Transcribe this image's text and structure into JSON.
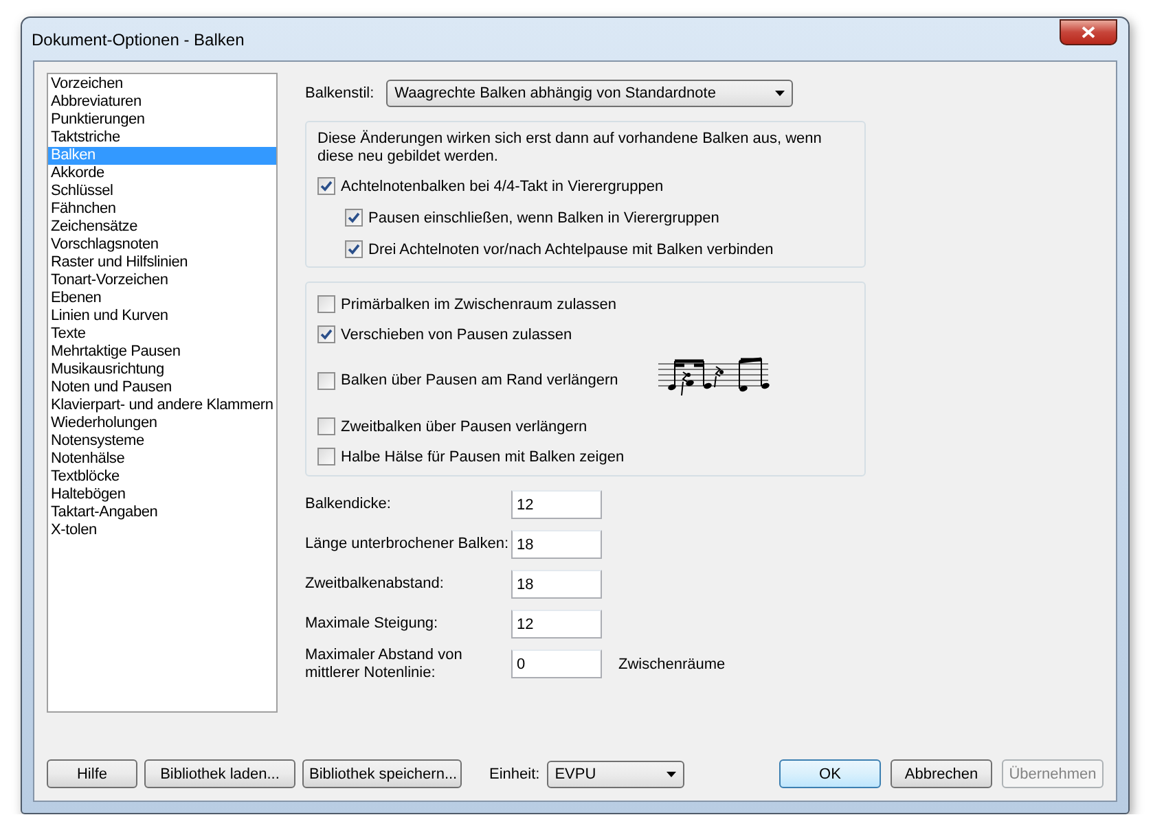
{
  "window": {
    "title": "Dokument-Optionen - Balken"
  },
  "sidebar": {
    "items": [
      {
        "label": "Vorzeichen",
        "selected": false
      },
      {
        "label": "Abbreviaturen",
        "selected": false
      },
      {
        "label": "Punktierungen",
        "selected": false
      },
      {
        "label": "Taktstriche",
        "selected": false
      },
      {
        "label": "Balken",
        "selected": true
      },
      {
        "label": "Akkorde",
        "selected": false
      },
      {
        "label": "Schlüssel",
        "selected": false
      },
      {
        "label": "Fähnchen",
        "selected": false
      },
      {
        "label": "Zeichensätze",
        "selected": false
      },
      {
        "label": "Vorschlagsnoten",
        "selected": false
      },
      {
        "label": "Raster und Hilfslinien",
        "selected": false
      },
      {
        "label": "Tonart-Vorzeichen",
        "selected": false
      },
      {
        "label": "Ebenen",
        "selected": false
      },
      {
        "label": "Linien und Kurven",
        "selected": false
      },
      {
        "label": "Texte",
        "selected": false
      },
      {
        "label": "Mehrtaktige Pausen",
        "selected": false
      },
      {
        "label": "Musikausrichtung",
        "selected": false
      },
      {
        "label": "Noten und Pausen",
        "selected": false
      },
      {
        "label": "Klavierpart- und andere Klammern",
        "selected": false
      },
      {
        "label": "Wiederholungen",
        "selected": false
      },
      {
        "label": "Notensysteme",
        "selected": false
      },
      {
        "label": "Notenhälse",
        "selected": false
      },
      {
        "label": "Textblöcke",
        "selected": false
      },
      {
        "label": "Haltebögen",
        "selected": false
      },
      {
        "label": "Taktart-Angaben",
        "selected": false
      },
      {
        "label": "X-tolen",
        "selected": false
      }
    ]
  },
  "beam_style": {
    "label": "Balkenstil:",
    "value": "Waagrechte Balken abhängig von Standardnote"
  },
  "group_1": {
    "note": "Diese Änderungen wirken sich erst dann auf vorhandene Balken aus, wenn diese neu gebildet werden.",
    "checkboxes": [
      {
        "label": "Achtelnotenbalken bei 4/4-Takt in Vierergruppen",
        "checked": true,
        "children": [
          {
            "label": "Pausen einschließen, wenn Balken in Vierergruppen",
            "checked": true
          },
          {
            "label": "Drei Achtelnoten vor/nach Achtelpause mit Balken verbinden",
            "checked": true
          }
        ]
      }
    ]
  },
  "group_2": {
    "checkboxes": [
      {
        "label": "Primärbalken im Zwischenraum zulassen",
        "checked": false
      },
      {
        "label": "Verschieben von Pausen zulassen",
        "checked": true
      },
      {
        "label": "Balken über Pausen am Rand verlängern",
        "checked": false
      },
      {
        "label": "Zweitbalken über Pausen verlängern",
        "checked": false
      },
      {
        "label": "Halbe Hälse für Pausen mit Balken zeigen",
        "checked": false
      }
    ]
  },
  "fields": [
    {
      "label": "Balkendicke:",
      "value": "12"
    },
    {
      "label": "Länge unterbrochener Balken:",
      "value": "18"
    },
    {
      "label": "Zweitbalkenabstand:",
      "value": "18"
    },
    {
      "label": "Maximale Steigung:",
      "value": "12"
    },
    {
      "label": "Maximaler Abstand von mittlerer Notenlinie:",
      "value": "0",
      "unit": "Zwischenräume"
    }
  ],
  "footer": {
    "left_buttons": [
      "Hilfe",
      "Bibliothek laden...",
      "Bibliothek speichern..."
    ],
    "unit": {
      "label": "Einheit:",
      "value": "EVPU"
    },
    "right_buttons": [
      {
        "label": "OK",
        "default": true,
        "disabled": false
      },
      {
        "label": "Abbrechen",
        "default": false,
        "disabled": false
      },
      {
        "label": "Übernehmen",
        "default": false,
        "disabled": true
      }
    ]
  }
}
